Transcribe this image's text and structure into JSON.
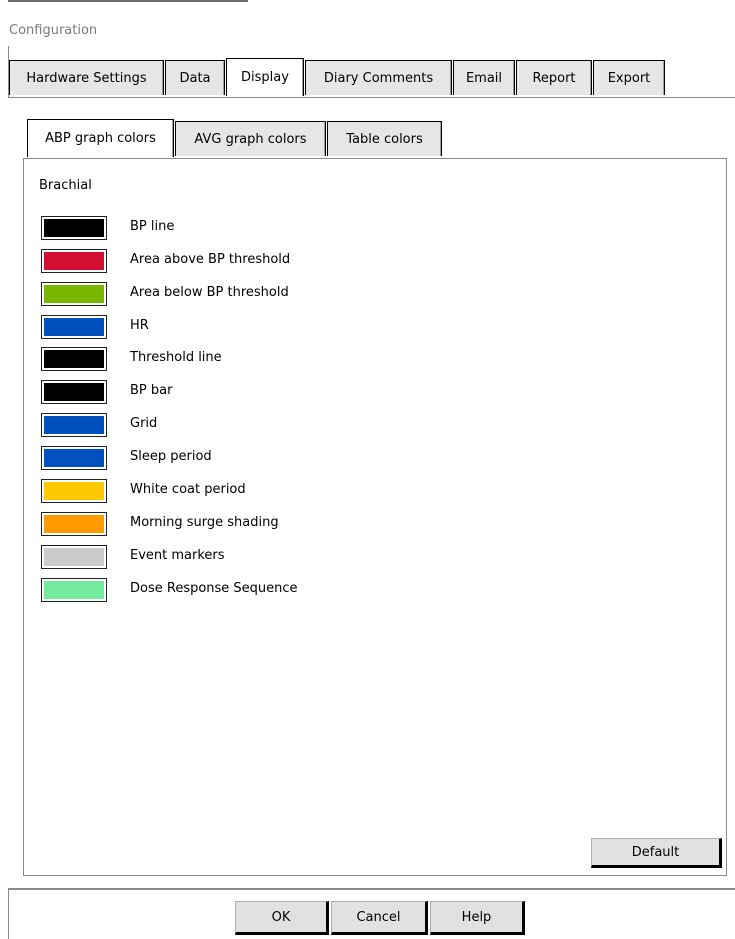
{
  "window": {
    "title": "Configuration"
  },
  "outer_tabs": [
    {
      "label": "Hardware Settings"
    },
    {
      "label": "Data"
    },
    {
      "label": "Display"
    },
    {
      "label": "Diary Comments"
    },
    {
      "label": "Email"
    },
    {
      "label": "Report"
    },
    {
      "label": "Export"
    }
  ],
  "active_outer_tab": "Display",
  "inner_tabs": [
    {
      "label": "ABP graph colors"
    },
    {
      "label": "AVG graph colors"
    },
    {
      "label": "Table colors"
    }
  ],
  "active_inner_tab": "ABP graph colors",
  "group_label": "Brachial",
  "color_items": [
    {
      "label": "BP line",
      "color": "#000000"
    },
    {
      "label": "Area above BP threshold",
      "color": "#d20f32"
    },
    {
      "label": "Area below BP threshold",
      "color": "#7ab800"
    },
    {
      "label": "HR",
      "color": "#0050c0"
    },
    {
      "label": "Threshold line",
      "color": "#000000"
    },
    {
      "label": "BP bar",
      "color": "#000000"
    },
    {
      "label": "Grid",
      "color": "#0050c0"
    },
    {
      "label": "Sleep period",
      "color": "#0050c0"
    },
    {
      "label": "White coat period",
      "color": "#ffc800"
    },
    {
      "label": "Morning surge shading",
      "color": "#ff9c00"
    },
    {
      "label": "Event markers",
      "color": "#cccccc"
    },
    {
      "label": "Dose Response Sequence",
      "color": "#74eb9c"
    }
  ],
  "buttons": {
    "default": "Default",
    "ok": "OK",
    "cancel": "Cancel",
    "help": "Help"
  }
}
